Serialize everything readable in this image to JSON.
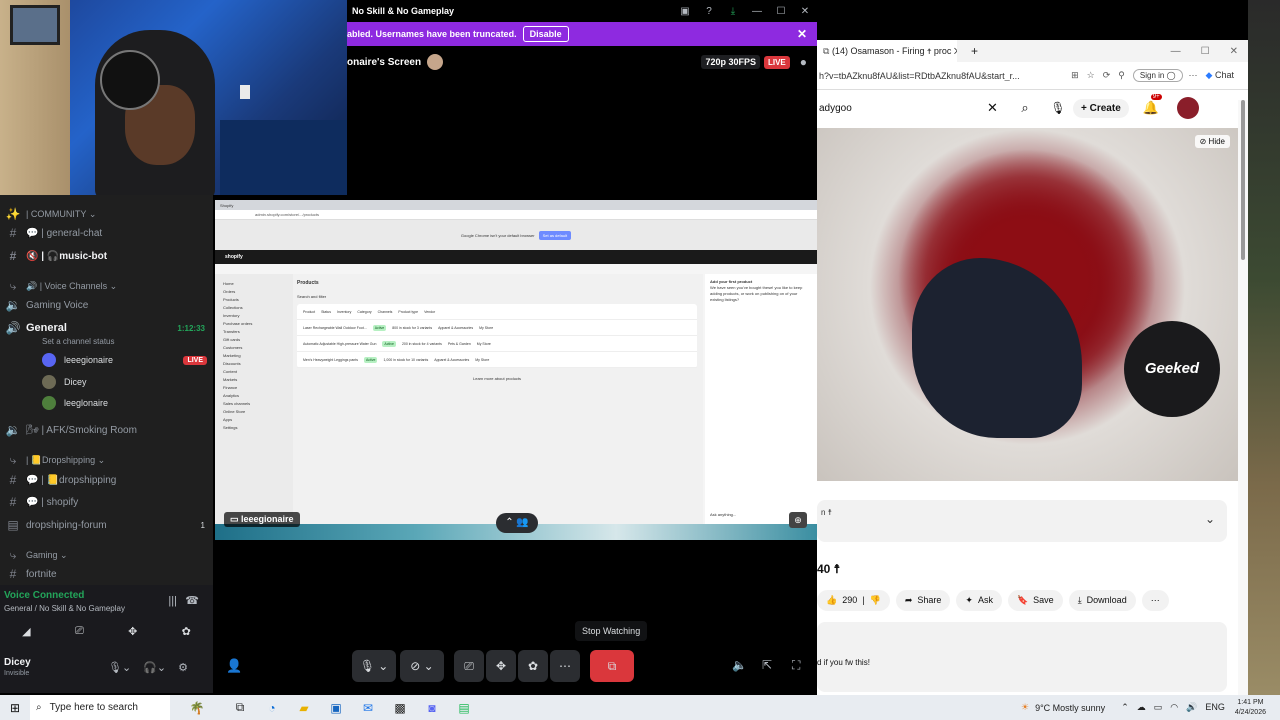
{
  "discord": {
    "window_title": "No Skill & No Gameplay",
    "notice": {
      "text": "abled. Usernames have been truncated.",
      "button": "Disable"
    },
    "stream": {
      "title": "onaire's Screen",
      "quality": "720p 30FPS",
      "live": "LIVE",
      "streamer_tag": "leeegionaire"
    },
    "sidebar": {
      "community_label": "| COMMUNITY",
      "channels": [
        {
          "name": "| general-chat",
          "type": "text"
        },
        {
          "name": "| 🎧music-bot",
          "type": "text"
        },
        {
          "name": "| Voice Channels",
          "type": "category"
        },
        {
          "name": "Gaming Voice",
          "type": "voice"
        },
        {
          "name": "General",
          "type": "voice-active",
          "timer": "1:12:33",
          "status": "Set a channel status"
        },
        {
          "name": "| AFK/Smoking Room",
          "type": "voice"
        },
        {
          "name": "| 📒Dropshipping",
          "type": "category"
        },
        {
          "name": "| 📒dropshipping",
          "type": "text"
        },
        {
          "name": "| shopify",
          "type": "text"
        },
        {
          "name": "dropshiping-forum",
          "type": "forum",
          "badge": "1"
        },
        {
          "name": "Gaming",
          "type": "category"
        },
        {
          "name": "fortnite",
          "type": "text"
        }
      ],
      "voice_users": [
        {
          "name": "leeegionaire",
          "live": "LIVE"
        },
        {
          "name": "Dicey"
        },
        {
          "name": "leeglonaire"
        }
      ]
    },
    "voice_panel": {
      "status": "Voice Connected",
      "location": "General / No Skill & No Gameplay"
    },
    "user": {
      "name": "Dicey",
      "status": "Invisible"
    },
    "tooltip": "Stop Watching"
  },
  "shared_screen": {
    "browser_tab": "Shopify",
    "url": "admin.shopify.com/store/.../products",
    "promo_text": "Google Chrome isn't your default browser",
    "promo_button": "Set as default",
    "shop_label": "shopify",
    "page_heading": "Products",
    "search_hint": "Search and filter",
    "nav": [
      "Home",
      "Orders",
      "Products",
      "Collections",
      "Inventory",
      "Purchase orders",
      "Transfers",
      "Gift cards",
      "Customers",
      "Marketing",
      "Discounts",
      "Content",
      "Markets",
      "Finance",
      "Analytics",
      "Sales channels",
      "Online Store",
      "Apps",
      "Settings"
    ],
    "columns": [
      "Product",
      "Status",
      "Inventory",
      "Category",
      "Channels",
      "Product type",
      "Vendor"
    ],
    "rows": [
      {
        "product": "Laser Rechargeable Wall Outdoor Foot...",
        "status": "Active",
        "inventory": "800 in stock for 3 variants",
        "category": "Apparel & Accessories",
        "vendor": "My Store"
      },
      {
        "product": "Automatic Adjustable High-pressure Water Gun",
        "status": "Active",
        "inventory": "200 in stock for 4 variants",
        "category": "Pets & Garden",
        "vendor": "My Store"
      },
      {
        "product": "Men's Heavyweight Leggings pants",
        "status": "Active",
        "inventory": "1,000 in stock for 10 variants",
        "category": "Apparel & Accessories",
        "vendor": "My Store"
      }
    ],
    "footer_link": "Learn more about products",
    "assistant_title": "Add your first product",
    "assistant_body": "We have seen you've bought these! you like to keep adding products, or work on publishing on of your existing listings?",
    "assistant_input": "Ask anything..."
  },
  "browser": {
    "tab_title": "(14) Osamason - Firing ☨ proc",
    "url": "h?v=tbAZknu8fAU&list=RDtbAZknu8fAU&start_r...",
    "sign_in": "Sign in",
    "chat": "Chat",
    "search_query": "adygoo",
    "create": "Create",
    "notif_count": "9+",
    "hide": "Hide",
    "video_logo": "Geeked",
    "desc_snippet": "n ☨",
    "count_text": "40 ☨",
    "likes": "290",
    "share": "Share",
    "ask": "Ask",
    "save": "Save",
    "download": "Download",
    "comment_snippet": "d if you fw this!"
  },
  "taskbar": {
    "search_placeholder": "Type here to search",
    "weather": "9°C  Mostly sunny",
    "lang": "ENG",
    "time": "1:41 PM",
    "date": "4/24/2026"
  }
}
